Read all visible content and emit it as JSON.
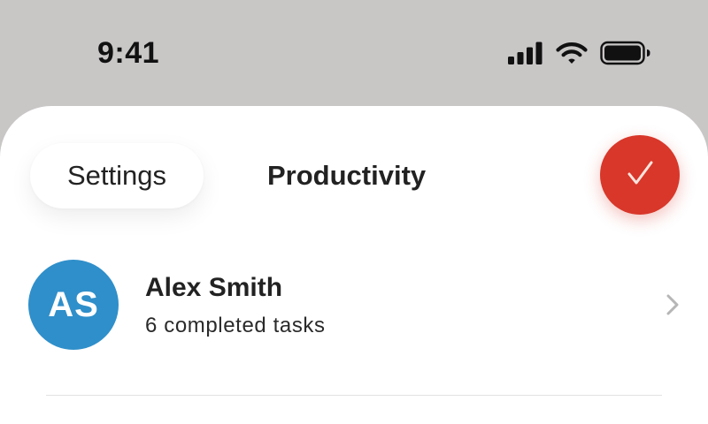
{
  "status_bar": {
    "time": "9:41",
    "icons": [
      "cellular-signal-icon",
      "wifi-icon",
      "battery-icon"
    ]
  },
  "header": {
    "tabs": [
      {
        "label": "Settings",
        "style": "pill"
      },
      {
        "label": "Productivity",
        "style": "plain"
      }
    ],
    "done_icon": "checkmark-icon"
  },
  "profile": {
    "initials": "AS",
    "name": "Alex Smith",
    "subtitle": "6 completed tasks",
    "chevron_icon": "chevron-right-icon"
  },
  "colors": {
    "background": "#c9c6c6",
    "sheet": "#ffffff",
    "accent_red": "#d8372a",
    "avatar_blue": "#2f8fca",
    "text": "#222222"
  }
}
